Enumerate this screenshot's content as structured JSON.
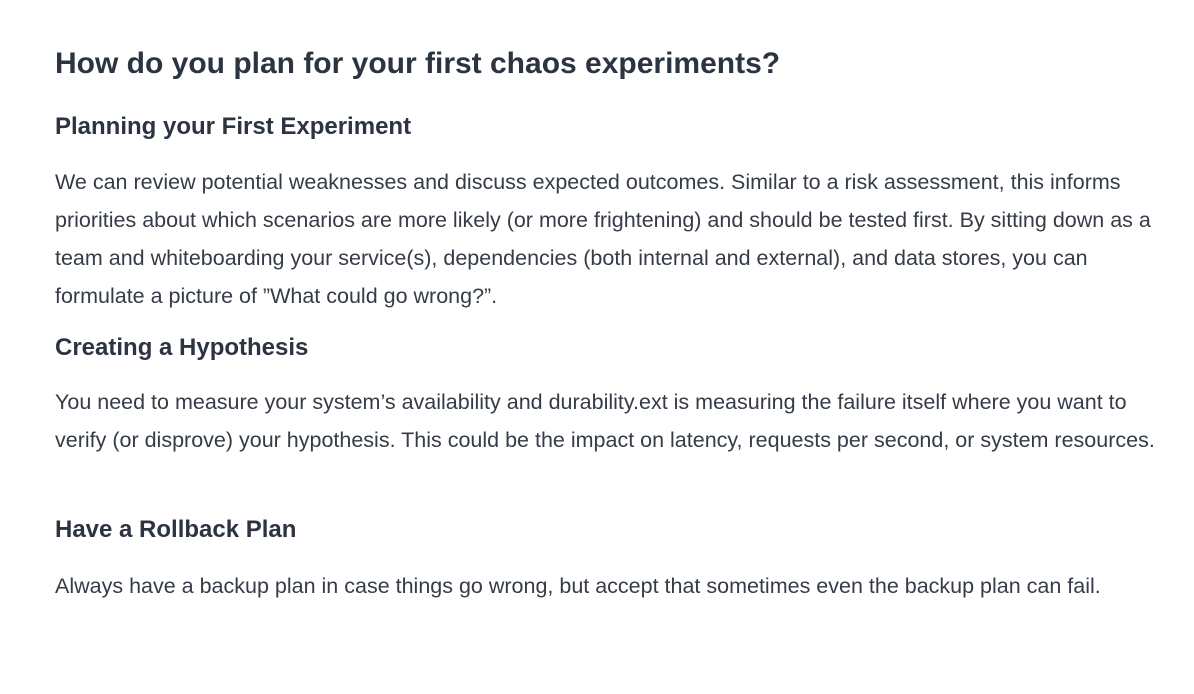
{
  "article": {
    "title": "How do you plan for your first chaos experiments?",
    "sections": [
      {
        "heading": "Planning your First Experiment",
        "body": "We can review potential weaknesses and discuss expected outcomes. Similar to a risk assessment, this informs priorities about which scenarios are more likely (or more frightening) and should be tested first. By sitting down as a team and whiteboarding your service(s), dependencies (both internal and external), and data stores, you can formulate a picture of ”What could go wrong?”."
      },
      {
        "heading": "Creating a Hypothesis",
        "body": "You need to measure your system’s availability and durability.ext is measuring the failure itself where you want to verify (or disprove) your hypothesis. This could be the impact on latency, requests per second, or system resources."
      },
      {
        "heading": "Have a Rollback Plan",
        "body": "Always have a backup plan in case things go wrong, but accept that sometimes even the backup plan can fail."
      }
    ]
  }
}
